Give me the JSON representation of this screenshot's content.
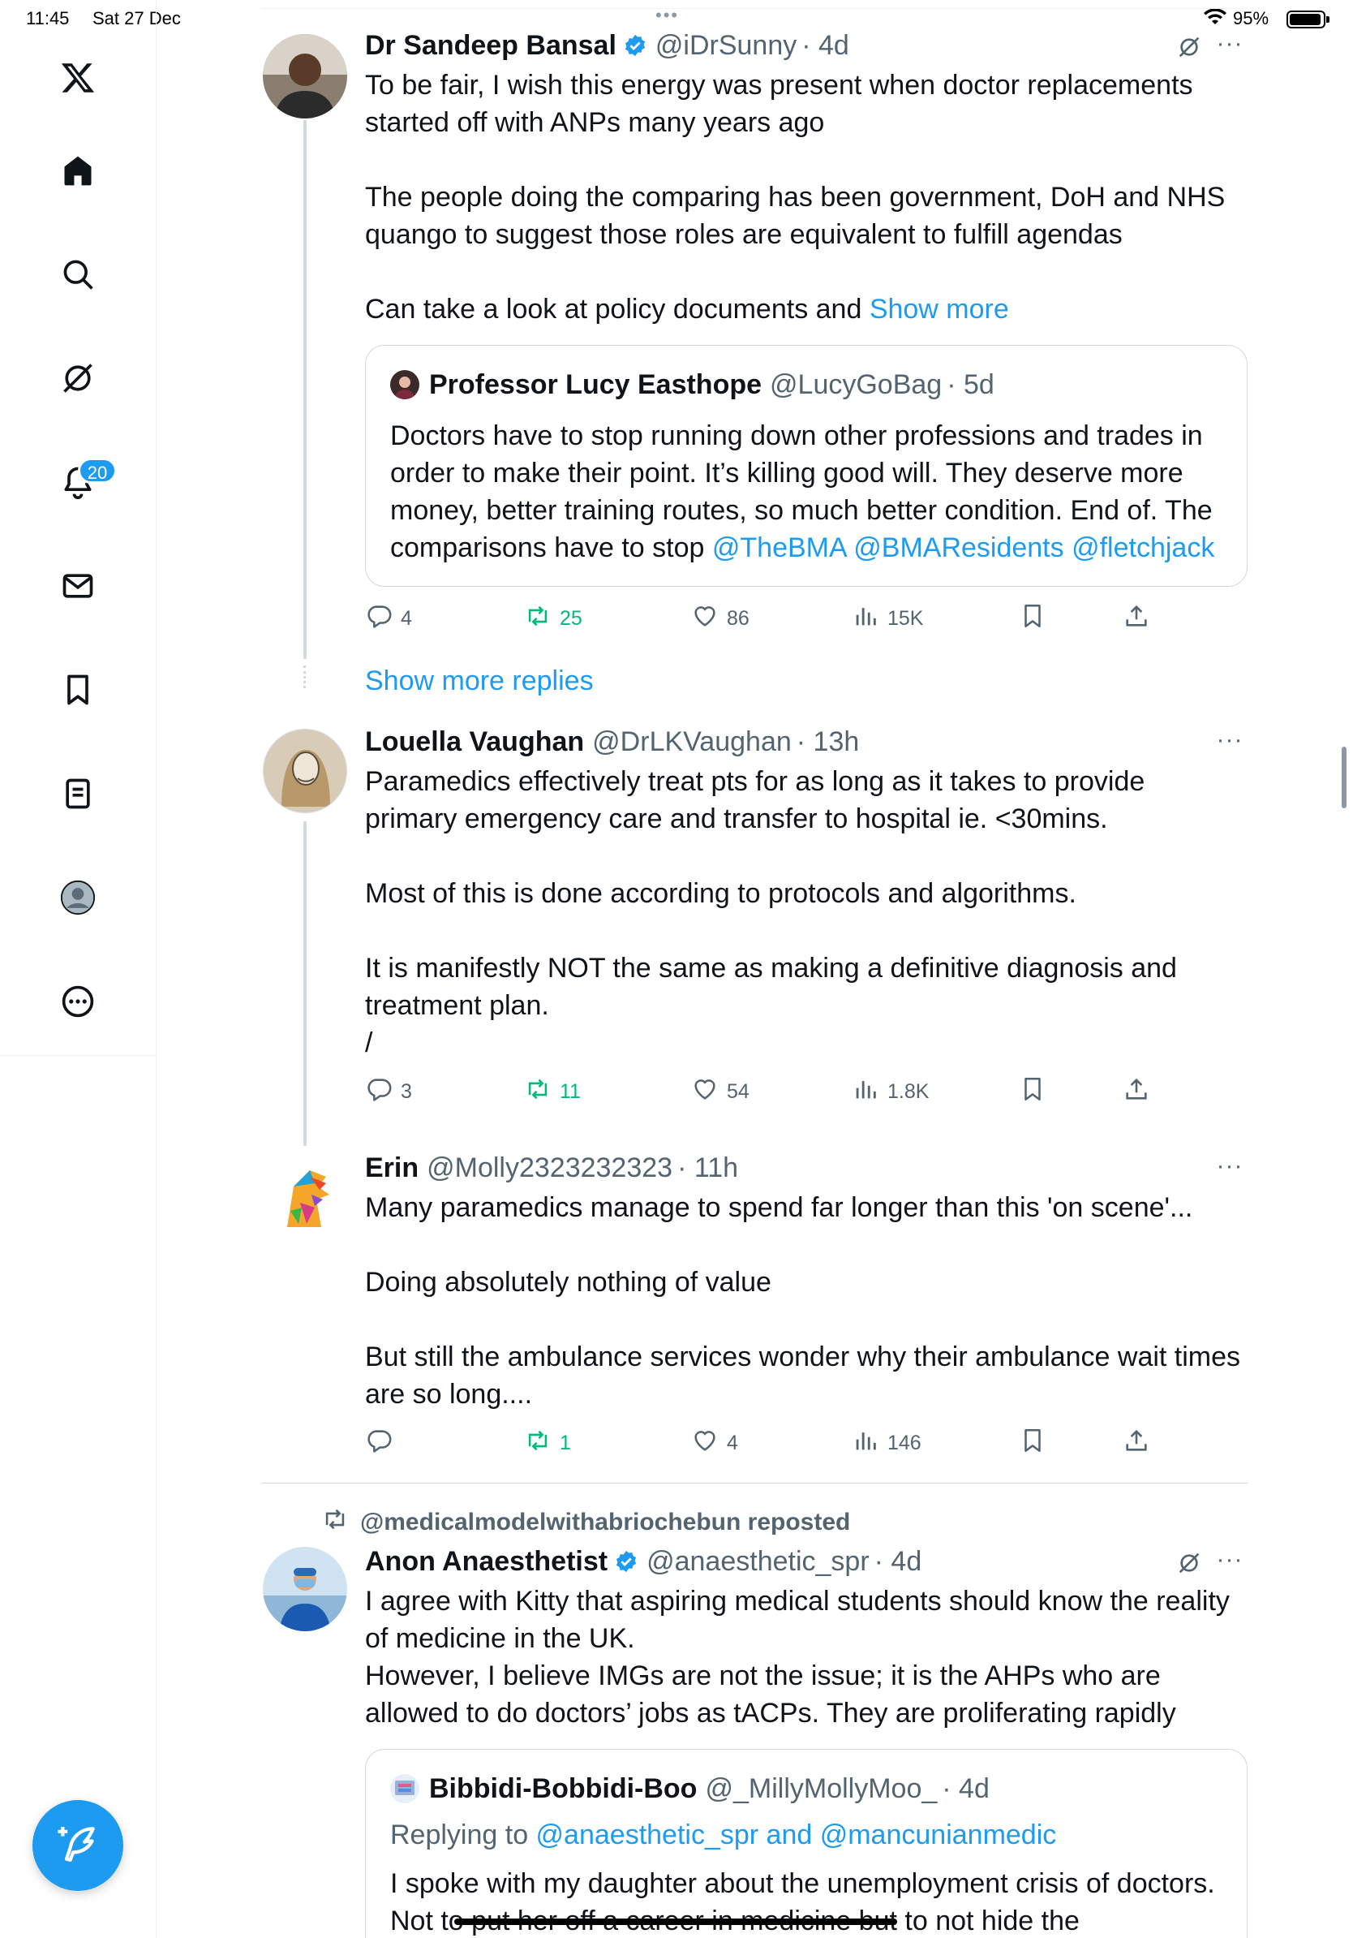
{
  "status_bar": {
    "time": "11:45",
    "date": "Sat 27 Dec",
    "multitask_dots": "•••",
    "battery": "95%",
    "battery_level": 0.95
  },
  "sidebar": {
    "badge_count": "20",
    "items": [
      {
        "icon": "x-logo-icon"
      },
      {
        "icon": "home-icon"
      },
      {
        "icon": "search-icon"
      },
      {
        "icon": "grok-icon"
      },
      {
        "icon": "notifications-bell-icon"
      },
      {
        "icon": "messages-envelope-icon"
      },
      {
        "icon": "bookmarks-icon"
      },
      {
        "icon": "lists-icon"
      },
      {
        "icon": "profile-avatar-icon"
      },
      {
        "icon": "more-circle-icon"
      }
    ],
    "compose_icon": "compose-feather-icon"
  },
  "colors": {
    "accent": "#1d9bf0",
    "repost_green": "#00ba7c",
    "muted": "#536471",
    "text": "#0f1419",
    "border": "#cfd9de"
  },
  "tweets": [
    {
      "name": "Dr Sandeep Bansal",
      "verified": true,
      "handle": "@iDrSunny",
      "time": "· 4d",
      "text": "To be fair, I wish this energy was present when doctor replacements started off with ANPs many years ago\n\nThe people doing the comparing has been government, DoH and NHS quango to suggest those roles are equivalent to fulfill agendas\n\nCan take a look at policy documents and ",
      "show_more": "Show more",
      "quote": {
        "name": "Professor Lucy Easthope",
        "handle": "@LucyGoBag",
        "time": "· 5d",
        "text": "Doctors have to stop running down other professions and trades in order to make their point. It’s killing good will. They deserve more money, better training routes, so much better condition. End of. The comparisons have to stop ",
        "mentions": [
          "@TheBMA",
          "@BMAResidents",
          "@fletchjack"
        ]
      },
      "stats": {
        "replies": "4",
        "reposts": "25",
        "likes": "86",
        "views": "15K"
      }
    },
    {
      "name": "Louella Vaughan",
      "handle": "@DrLKVaughan",
      "time": "· 13h",
      "text": "Paramedics effectively treat pts for as long as it takes to provide primary emergency care and transfer to hospital ie. <30mins.\n\nMost of this is done according to protocols and algorithms.\n\nIt is manifestly NOT the same as making a definitive diagnosis and treatment plan.\n/",
      "stats": {
        "replies": "3",
        "reposts": "11",
        "likes": "54",
        "views": "1.8K"
      }
    },
    {
      "name": "Erin",
      "handle": "@Molly2323232323",
      "time": "· 11h",
      "text": "Many paramedics manage to spend far longer than this 'on scene'...\n\nDoing absolutely nothing of value\n\nBut still the ambulance services wonder why their ambulance wait times are so long....",
      "stats": {
        "replies": "",
        "reposts": "1",
        "likes": "4",
        "views": "146"
      }
    },
    {
      "reposted_by": "@medicalmodelwithabriochebun reposted",
      "name": "Anon Anaesthetist",
      "verified": true,
      "handle": "@anaesthetic_spr",
      "time": "· 4d",
      "text": "I agree with Kitty that aspiring medical students should know the reality of medicine in the UK.\nHowever, I believe IMGs are not the issue; it is the AHPs who are allowed to do doctors’ jobs as tACPs. They are proliferating rapidly",
      "quote": {
        "name": "Bibbidi-Bobbidi-Boo",
        "handle": "@_MillyMollyMoo_",
        "time": "· 4d",
        "replying_prefix": "Replying to ",
        "replying_to": "@anaesthetic_spr and @mancunianmedic",
        "text": "I spoke with my daughter about the unemployment crisis of doctors. Not to put her off a career in medicine but to not hide the"
      }
    }
  ],
  "show_more_replies": "Show more replies"
}
